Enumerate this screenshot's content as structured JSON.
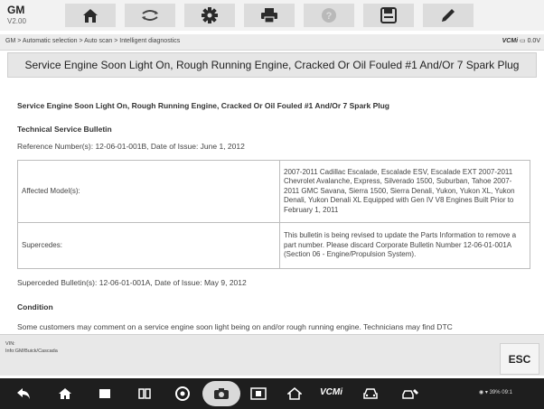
{
  "app": {
    "name": "GM",
    "version": "V2.00"
  },
  "toolbar": {
    "buttons": [
      {
        "icon": "home-icon"
      },
      {
        "icon": "vehicle-swap-icon"
      },
      {
        "icon": "settings-icon"
      },
      {
        "icon": "print-icon"
      },
      {
        "icon": "help-icon"
      },
      {
        "icon": "save-icon"
      },
      {
        "icon": "edit-icon"
      }
    ]
  },
  "breadcrumb": "GM > Automatic selection > Auto scan > Intelligent diagnostics",
  "vcm_status": {
    "label": "VCMi",
    "value": "0.0V"
  },
  "page_title": "Service Engine Soon Light On, Rough Running Engine, Cracked Or Oil Fouled #1 And/Or 7 Spark Plug",
  "document": {
    "heading": "Service Engine Soon Light On, Rough Running Engine, Cracked Or Oil Fouled #1 And/Or 7 Spark Plug",
    "subheading": "Technical Service Bulletin",
    "reference": "Reference Number(s): 12-06-01-001B, Date of Issue:  June 1, 2012",
    "table": [
      {
        "label": "Affected Model(s):",
        "value": "2007-2011 Cadillac Escalade, Escalade ESV, Escalade EXT 2007-2011 Chevrolet Avalanche, Express, Silverado 1500, Suburban, Tahoe 2007-2011 GMC Savana, Sierra 1500, Sierra Denali, Yukon, Yukon XL, Yukon Denali, Yukon Denali XL Equipped with Gen IV V8 Engines Built Prior to February 1, 2011"
      },
      {
        "label": "Supercedes:",
        "value": "This bulletin is being revised to update the Parts Information to remove a part number. Please discard Corporate Bulletin Number 12-06-01-001A (Section 06 - Engine/Propulsion System)."
      }
    ],
    "superseded": "Superceded Bulletin(s): 12-06-01-001A, Date of Issue:  May 9, 2012",
    "condition_heading": "Condition",
    "condition_text": "Some customers may comment on a service engine soon light being on and/or rough running engine. Technicians may find DTC"
  },
  "footer": {
    "vin": "VIN:",
    "info": "Info:GM/Buick/Cascada",
    "esc_label": "ESC"
  },
  "navbar": {
    "vcm_label": "VCMi",
    "status": "39% 09:1"
  },
  "colors": {
    "toolbar_bg": "#f2f2f2",
    "tool_button": "#dcdcdc",
    "navbar_bg": "#1e1e1e",
    "title_bg": "#e6e6e6"
  }
}
